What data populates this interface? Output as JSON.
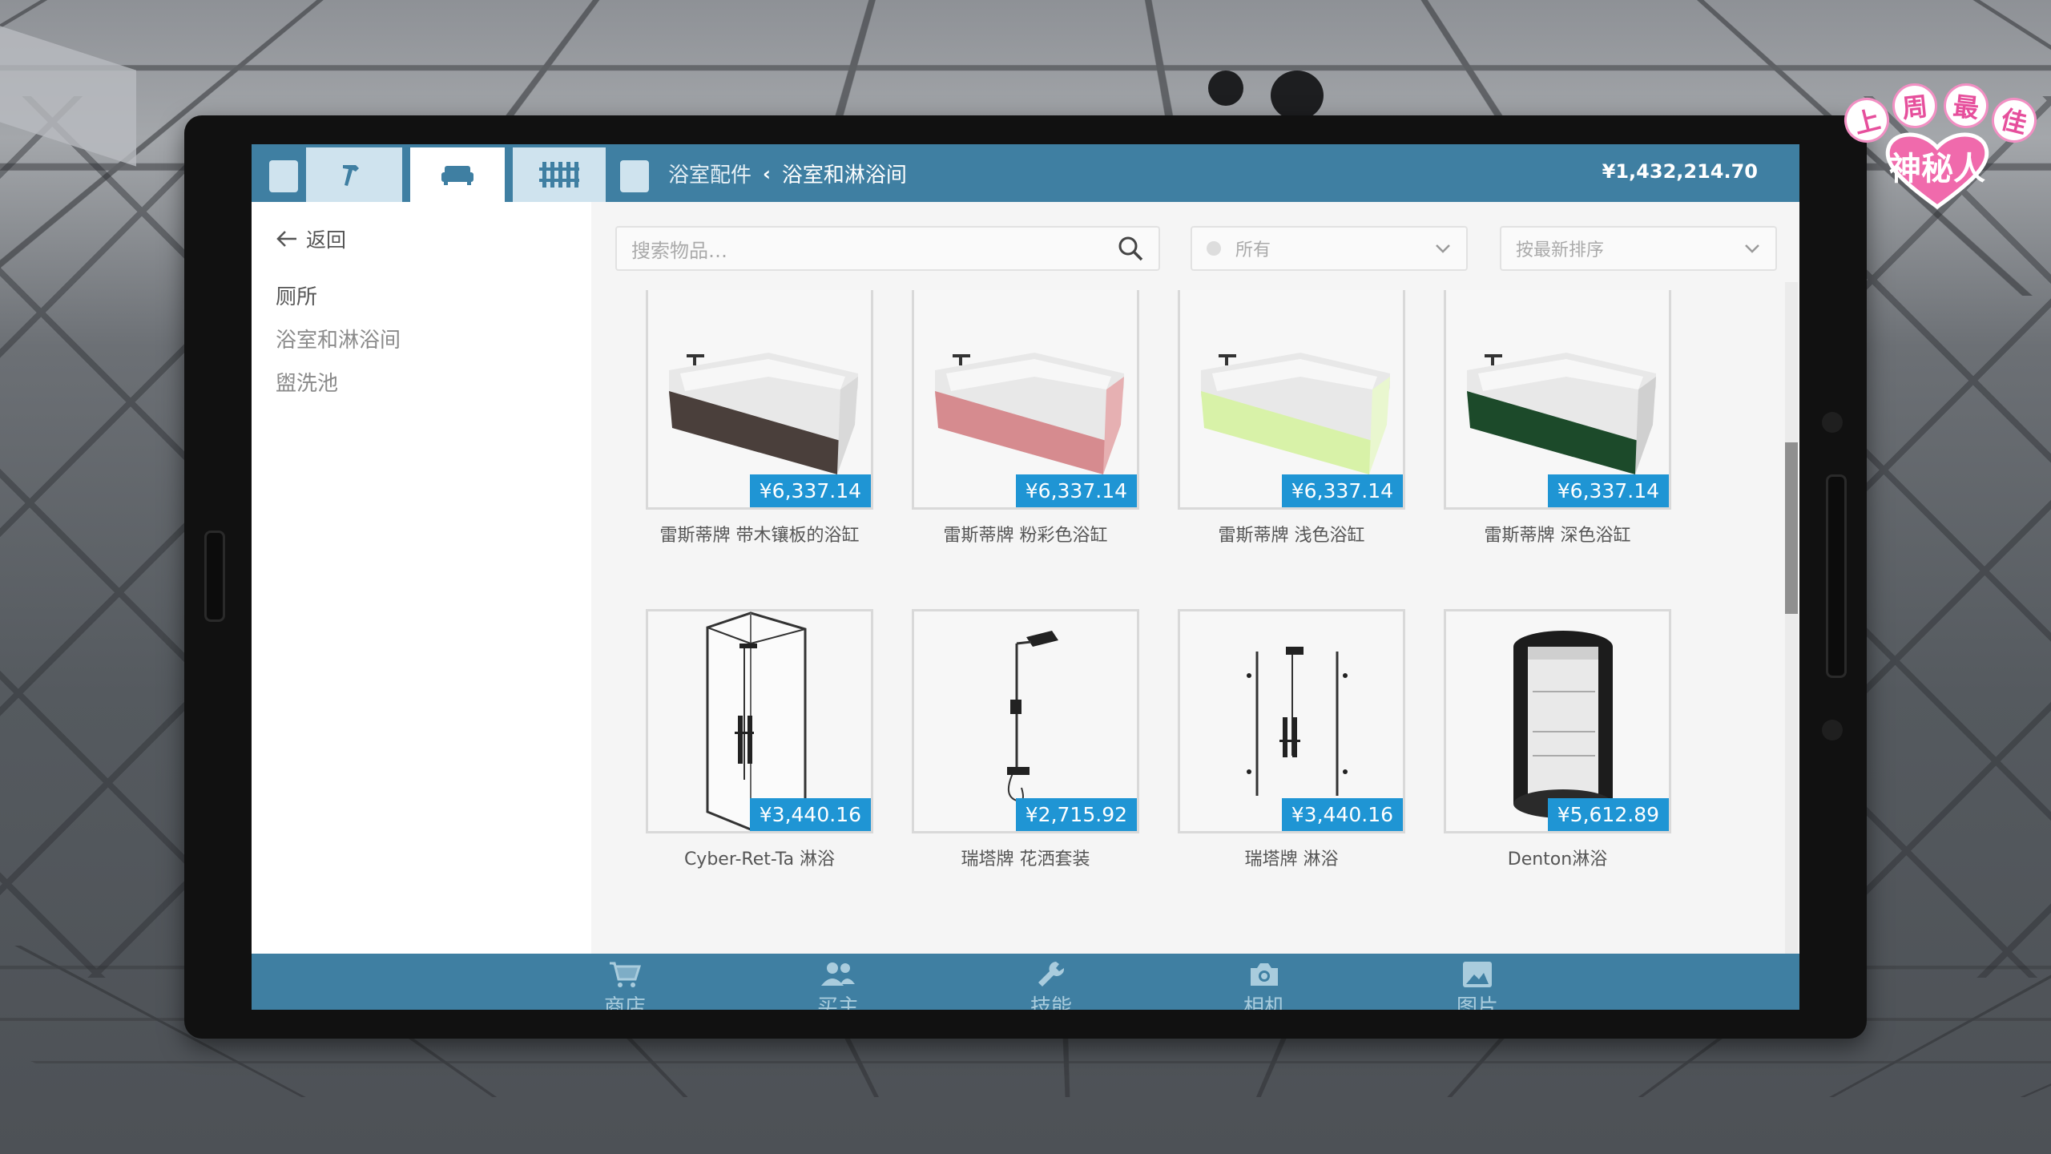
{
  "topbar": {
    "breadcrumb_parent": "浴室配件",
    "breadcrumb_current": "浴室和淋浴间",
    "balance": "¥1,432,214.70",
    "tabs": [
      {
        "icon": "hammer-icon",
        "active": false
      },
      {
        "icon": "sofa-icon",
        "active": true
      },
      {
        "icon": "fence-icon",
        "active": false
      }
    ]
  },
  "sidebar": {
    "back_label": "返回",
    "categories": [
      "厕所",
      "浴室和淋浴间",
      "盥洗池"
    ]
  },
  "filters": {
    "search_placeholder": "搜索物品…",
    "filter_value": "所有",
    "sort_value": "按最新排序"
  },
  "items": [
    {
      "name": "雷斯蒂牌 带木镶板的浴缸",
      "price": "¥6,337.14",
      "color": "#4a3f3b"
    },
    {
      "name": "雷斯蒂牌 粉彩色浴缸",
      "price": "¥6,337.14",
      "color": "#d68b8f"
    },
    {
      "name": "雷斯蒂牌 浅色浴缸",
      "price": "¥6,337.14",
      "color": "#d8f2a8"
    },
    {
      "name": "雷斯蒂牌 深色浴缸",
      "price": "¥6,337.14",
      "color": "#1c4a2a"
    },
    {
      "name": "Cyber-Ret-Ta 淋浴",
      "price": "¥3,440.16"
    },
    {
      "name": "瑞塔牌 花洒套装",
      "price": "¥2,715.92"
    },
    {
      "name": "瑞塔牌 淋浴",
      "price": "¥3,440.16"
    },
    {
      "name": "Denton淋浴",
      "price": "¥5,612.89"
    }
  ],
  "bottomnav": [
    {
      "label": "商店",
      "icon": "cart-icon"
    },
    {
      "label": "买主",
      "icon": "people-icon"
    },
    {
      "label": "技能",
      "icon": "wrench-icon"
    },
    {
      "label": "相机",
      "icon": "camera-icon"
    },
    {
      "label": "图片",
      "icon": "image-icon"
    }
  ],
  "watermark": {
    "chars": [
      "上",
      "周",
      "最",
      "佳"
    ],
    "heart_text": "神秘人"
  },
  "colors": {
    "accent": "#3f7fa2",
    "price_badge": "#1f95d4"
  }
}
